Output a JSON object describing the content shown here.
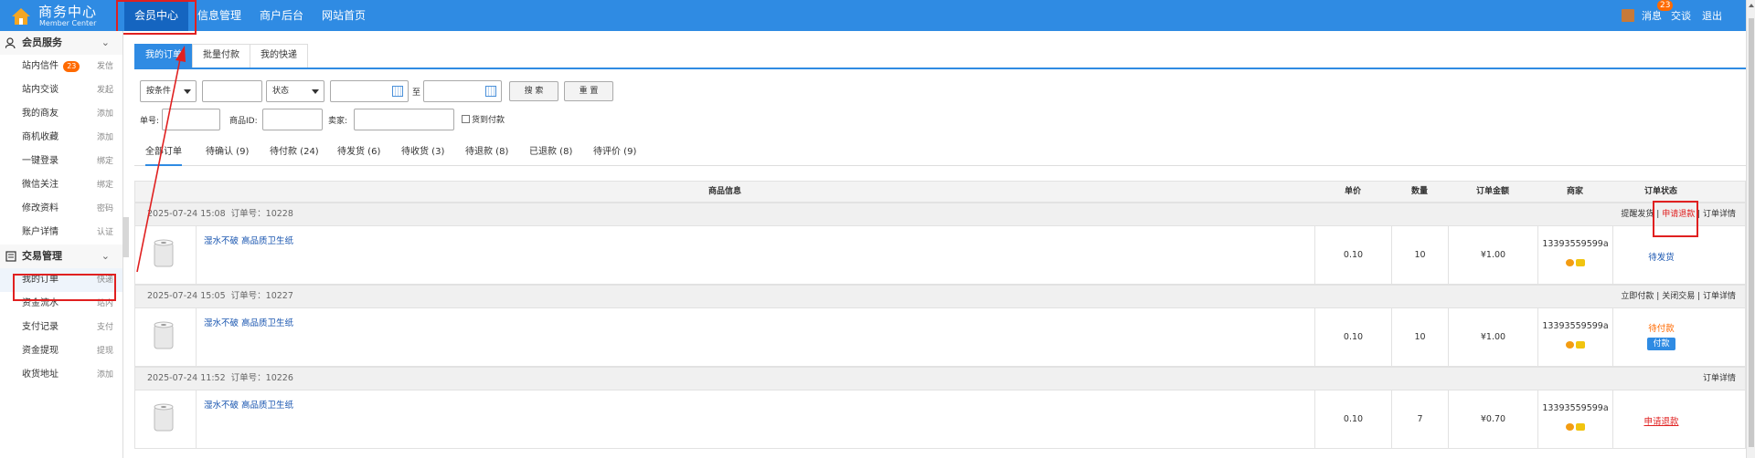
{
  "header": {
    "logo_title": "商务中心",
    "logo_subtitle": "Member Center",
    "nav": [
      "会员中心",
      "信息管理",
      "商户后台",
      "网站首页"
    ],
    "messages_label": "消息",
    "messages_count": "23",
    "trade_label": "交谈",
    "logout_label": "退出"
  },
  "sidebar": {
    "groups": [
      {
        "title": "会员服务",
        "items": [
          {
            "label": "站内信件",
            "badge": "23",
            "action": "发信"
          },
          {
            "label": "站内交谈",
            "action": "发起"
          },
          {
            "label": "我的商友",
            "action": "添加"
          },
          {
            "label": "商机收藏",
            "action": "添加"
          },
          {
            "label": "一键登录",
            "action": "绑定"
          },
          {
            "label": "微信关注",
            "action": "绑定"
          },
          {
            "label": "修改资料",
            "action": "密码"
          },
          {
            "label": "账户详情",
            "action": "认证"
          }
        ]
      },
      {
        "title": "交易管理",
        "items": [
          {
            "label": "我的订单",
            "action": "快递"
          },
          {
            "label": "资金流水",
            "action": "站内"
          },
          {
            "label": "支付记录",
            "action": "支付"
          },
          {
            "label": "资金提现",
            "action": "提现"
          },
          {
            "label": "收货地址",
            "action": "添加"
          }
        ]
      }
    ]
  },
  "tabs": [
    "我的订单",
    "批量付款",
    "我的快递"
  ],
  "filters": {
    "search_by": "按条件",
    "status": "状态",
    "to_label": "至",
    "search_btn": "搜 索",
    "reset_btn": "重 置",
    "order_no_label": "单号:",
    "product_id_label": "商品ID:",
    "seller_label": "卖家:",
    "cod_label": "货到付款"
  },
  "order_tabs": [
    "全部订单",
    "待确认 (9)",
    "待付款 (24)",
    "待发货 (6)",
    "待收货 (3)",
    "待退款 (8)",
    "已退款 (8)",
    "待评价 (9)"
  ],
  "table_headers": [
    "商品信息",
    "单价",
    "数量",
    "订单金额",
    "商家",
    "订单状态"
  ],
  "orders": [
    {
      "date": "2025-07-24 15:08",
      "order_no": "订单号：10228",
      "actions": [
        "提醒发货",
        "申请退款",
        "订单详情"
      ],
      "product": "湿水不破 高品质卫生纸",
      "price": "0.10",
      "qty": "10",
      "amount": "¥1.00",
      "seller": "13393559599a",
      "status": "待发货"
    },
    {
      "date": "2025-07-24 15:05",
      "order_no": "订单号：10227",
      "actions": [
        "立即付款",
        "关闭交易",
        "订单详情"
      ],
      "product": "湿水不破 高品质卫生纸",
      "price": "0.10",
      "qty": "10",
      "amount": "¥1.00",
      "seller": "13393559599a",
      "status": "待付款",
      "pay_btn": "付款"
    },
    {
      "date": "2025-07-24 11:52",
      "order_no": "订单号：10226",
      "actions": [
        "订单详情"
      ],
      "product": "湿水不破 高品质卫生纸",
      "price": "0.10",
      "qty": "7",
      "amount": "¥0.70",
      "seller": "13393559599a",
      "status": "申请退款"
    }
  ],
  "colors": {
    "primary": "#2f8be3",
    "highlight": "#e02020",
    "badge": "#ff6a00"
  }
}
